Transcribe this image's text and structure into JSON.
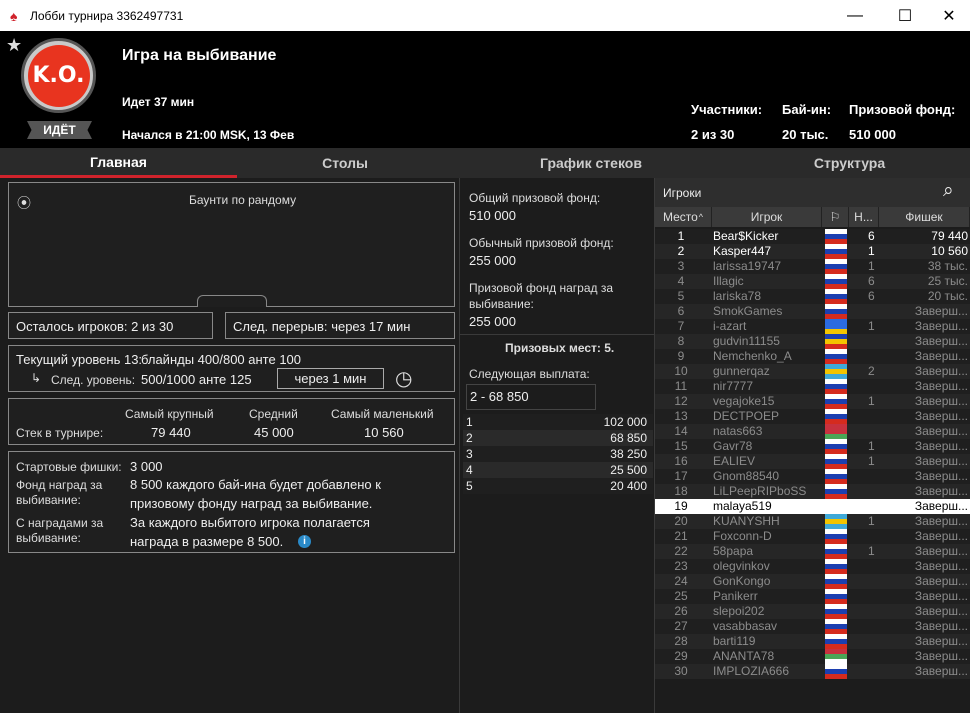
{
  "window": {
    "title": "Лобби турнира 3362497731"
  },
  "header": {
    "title": "Игра на выбивание",
    "status_badge": "ИДЁТ",
    "running": "Идет 37 мин",
    "started": "Начался в 21:00 MSK, 13 Фев",
    "participants_label": "Участники:",
    "participants_value": "2 из 30",
    "buyin_label": "Бай-ин:",
    "buyin_value": "20 тыс.",
    "prizepool_label": "Призовой фонд:",
    "prizepool_value": "510 000",
    "ko_logo_text": "K.O."
  },
  "tabs": [
    {
      "label": "Главная"
    },
    {
      "label": "Столы"
    },
    {
      "label": "График стеков"
    },
    {
      "label": "Структура"
    }
  ],
  "main": {
    "bounty_title": "Баунти по рандому",
    "players_left_label": "Осталось игроков:",
    "players_left_value": "2 из 30",
    "next_break_label": "След. перерыв:",
    "next_break_value": "через 17 мин",
    "current_level_label": "Текущий уровень 13:",
    "current_level_value": "блайнды 400/800 анте  100",
    "next_level_label": "След. уровень:",
    "next_level_value": "500/1000 анте  125",
    "next_level_timer": "через 1 мин",
    "stack_label": "Стек в турнире:",
    "largest_label": "Самый крупный",
    "largest_value": "79 440",
    "average_label": "Средний",
    "average_value": "45 000",
    "smallest_label": "Самый маленький",
    "smallest_value": "10 560",
    "starting_chips_label": "Стартовые фишки:",
    "starting_chips_value": "3 000",
    "bounty_fund_label1": "Фонд наград за",
    "bounty_fund_label2": "выбивание:",
    "bounty_fund_value1": "8 500 каждого бай-ина будет добавлено к",
    "bounty_fund_value2": "призовому фонду наград за выбивание.",
    "with_bounties_label1": "С наградами за",
    "with_bounties_label2": "выбивание:",
    "with_bounties_value1": "За каждого выбитого игрока полагается",
    "with_bounties_value2": "награда в размере 8 500."
  },
  "prizes": {
    "total_label": "Общий призовой фонд:",
    "total_value": "510 000",
    "regular_label": "Обычный призовой фонд:",
    "regular_value": "255 000",
    "bounty_label1": "Призовой фонд наград за",
    "bounty_label2": "выбивание:",
    "bounty_value": "255 000",
    "places_label": "Призовых мест: 5.",
    "next_payout_label": "Следующая выплата:",
    "next_payout_value": "2 - 68 850",
    "rows": [
      {
        "place": "1",
        "amount": "102 000"
      },
      {
        "place": "2",
        "amount": "68 850"
      },
      {
        "place": "3",
        "amount": "38 250"
      },
      {
        "place": "4",
        "amount": "25 500"
      },
      {
        "place": "5",
        "amount": "20 400"
      }
    ]
  },
  "players": {
    "search_placeholder": "Игроки",
    "columns": {
      "place": "Место",
      "player": "Игрок",
      "n": "Н...",
      "chips": "Фишек"
    },
    "rows": [
      {
        "place": "1",
        "name": "Bear$Kicker",
        "n": "6",
        "chips": "79 440",
        "active": true
      },
      {
        "place": "2",
        "name": "Kasper447",
        "n": "1",
        "chips": "10 560",
        "active": true
      },
      {
        "place": "3",
        "name": "larissa19747",
        "n": "1",
        "chips": "38 тыс."
      },
      {
        "place": "4",
        "name": "Illagic",
        "n": "6",
        "chips": "25 тыс."
      },
      {
        "place": "5",
        "name": "lariska78",
        "n": "6",
        "chips": "20 тыс."
      },
      {
        "place": "6",
        "name": "SmokGames",
        "n": "",
        "chips": "Заверш..."
      },
      {
        "place": "7",
        "name": "i-azart",
        "n": "1",
        "chips": "Заверш..."
      },
      {
        "place": "8",
        "name": "gudvin11155",
        "n": "",
        "chips": "Заверш..."
      },
      {
        "place": "9",
        "name": "Nemchenko_A",
        "n": "",
        "chips": "Заверш..."
      },
      {
        "place": "10",
        "name": "gunnerqaz",
        "n": "2",
        "chips": "Заверш..."
      },
      {
        "place": "11",
        "name": "nir7777",
        "n": "",
        "chips": "Заверш..."
      },
      {
        "place": "12",
        "name": "vegajoke15",
        "n": "1",
        "chips": "Заверш..."
      },
      {
        "place": "13",
        "name": "DECTPOEP",
        "n": "",
        "chips": "Заверш..."
      },
      {
        "place": "14",
        "name": "natas663",
        "n": "",
        "chips": "Заверш..."
      },
      {
        "place": "15",
        "name": "Gavr78",
        "n": "1",
        "chips": "Заверш..."
      },
      {
        "place": "16",
        "name": "EALIEV",
        "n": "1",
        "chips": "Заверш..."
      },
      {
        "place": "17",
        "name": "Gnom88540",
        "n": "",
        "chips": "Заверш..."
      },
      {
        "place": "18",
        "name": "LiLPeepRIPboSS",
        "n": "",
        "chips": "Заверш..."
      },
      {
        "place": "19",
        "name": "malaya519",
        "n": "",
        "chips": "Заверш...",
        "selected": true
      },
      {
        "place": "20",
        "name": "KUANYSHH",
        "n": "1",
        "chips": "Заверш..."
      },
      {
        "place": "21",
        "name": "Foxconn-D",
        "n": "",
        "chips": "Заверш..."
      },
      {
        "place": "22",
        "name": "58papa",
        "n": "1",
        "chips": "Заверш..."
      },
      {
        "place": "23",
        "name": "olegvinkov",
        "n": "",
        "chips": "Заверш..."
      },
      {
        "place": "24",
        "name": "GonKongo",
        "n": "",
        "chips": "Заверш..."
      },
      {
        "place": "25",
        "name": "Panikerr",
        "n": "",
        "chips": "Заверш..."
      },
      {
        "place": "26",
        "name": "slepoi202",
        "n": "",
        "chips": "Заверш..."
      },
      {
        "place": "27",
        "name": "vasabbasav",
        "n": "",
        "chips": "Заверш..."
      },
      {
        "place": "28",
        "name": "barti119",
        "n": "",
        "chips": "Заверш..."
      },
      {
        "place": "29",
        "name": "ANANTA78",
        "n": "",
        "chips": "Заверш..."
      },
      {
        "place": "30",
        "name": "IMPLOZIA666",
        "n": "",
        "chips": "Заверш..."
      }
    ]
  },
  "colors": {
    "accent": "#d0232c",
    "selected_row": "#ffffff"
  }
}
